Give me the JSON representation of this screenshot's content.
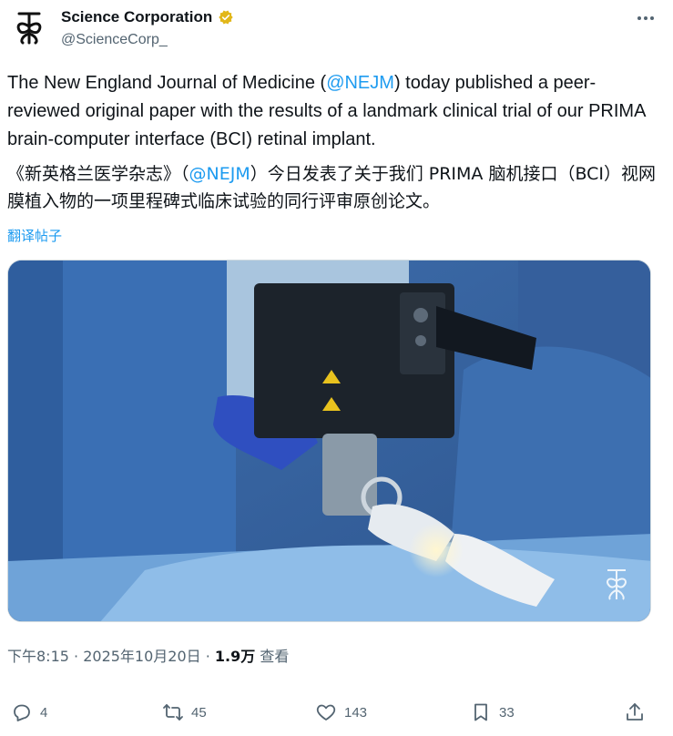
{
  "author": {
    "display_name": "Science Corporation",
    "handle": "@ScienceCorp_",
    "verified_icon": "verified-badge-gold",
    "avatar_icon": "science-corp-logo"
  },
  "tweet": {
    "en_before": "The New England Journal of Medicine (",
    "en_mention": "@NEJM",
    "en_after": ") today published a peer-reviewed original paper with the results of a landmark clinical trial of our PRIMA brain-computer interface (BCI) retinal implant.",
    "zh_before": "《新英格兰医学杂志》（",
    "zh_mention": "@NEJM",
    "zh_after": "）今日发表了关于我们 PRIMA 脑机接口（BCI）视网膜植入物的一项里程碑式临床试验的同行评审原创论文。",
    "translate_label": "翻译帖子"
  },
  "meta": {
    "time": "下午8:15",
    "sep1": " · ",
    "date": "2025年10月20日",
    "sep2": " · ",
    "views": "1.9万",
    "views_label": " 查看"
  },
  "actions": {
    "replies": "4",
    "reposts": "45",
    "likes": "143",
    "bookmarks": "33"
  },
  "colors": {
    "accent": "#1d9bf0",
    "secondary_text": "#536471",
    "primary_text": "#0f1419"
  }
}
